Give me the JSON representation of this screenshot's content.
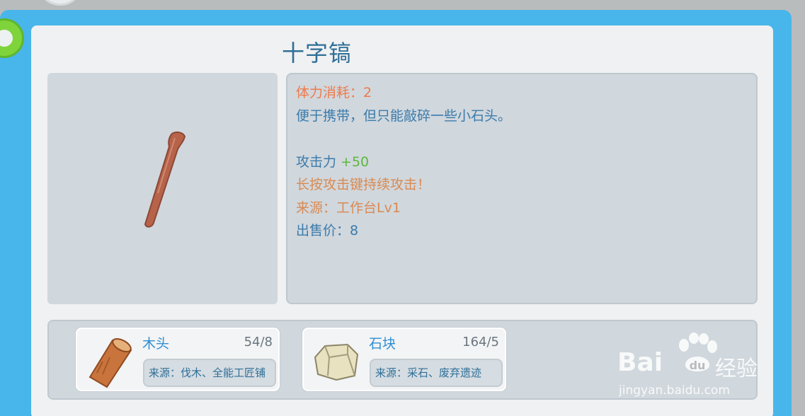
{
  "item": {
    "title": "十字镐",
    "icon": "pickaxe-handle-icon"
  },
  "description": {
    "stamina": "体力消耗：2",
    "text": "便于携带，但只能敲碎一些小石头。",
    "attack_label": "攻击力 ",
    "attack_value": "+50",
    "hint": "长按攻击键持续攻击！",
    "source": "来源：工作台Lv1",
    "price": "出售价：8"
  },
  "materials": [
    {
      "name": "木头",
      "count": "54/8",
      "source": "来源：伐木、全能工匠铺",
      "icon": "wood-log-icon"
    },
    {
      "name": "石块",
      "count": "164/5",
      "source": "来源：采石、废弃遗迹",
      "icon": "stone-block-icon"
    }
  ],
  "watermark": {
    "logo": "Bai",
    "logo_du": "du",
    "cn": "经验",
    "url": "jingyan.baidu.com"
  },
  "colors": {
    "frame": "#48b6ea",
    "title": "#2f6f97",
    "stamina": "#ef7a4c",
    "attack_value": "#5cb83c",
    "hint": "#d98a52"
  }
}
